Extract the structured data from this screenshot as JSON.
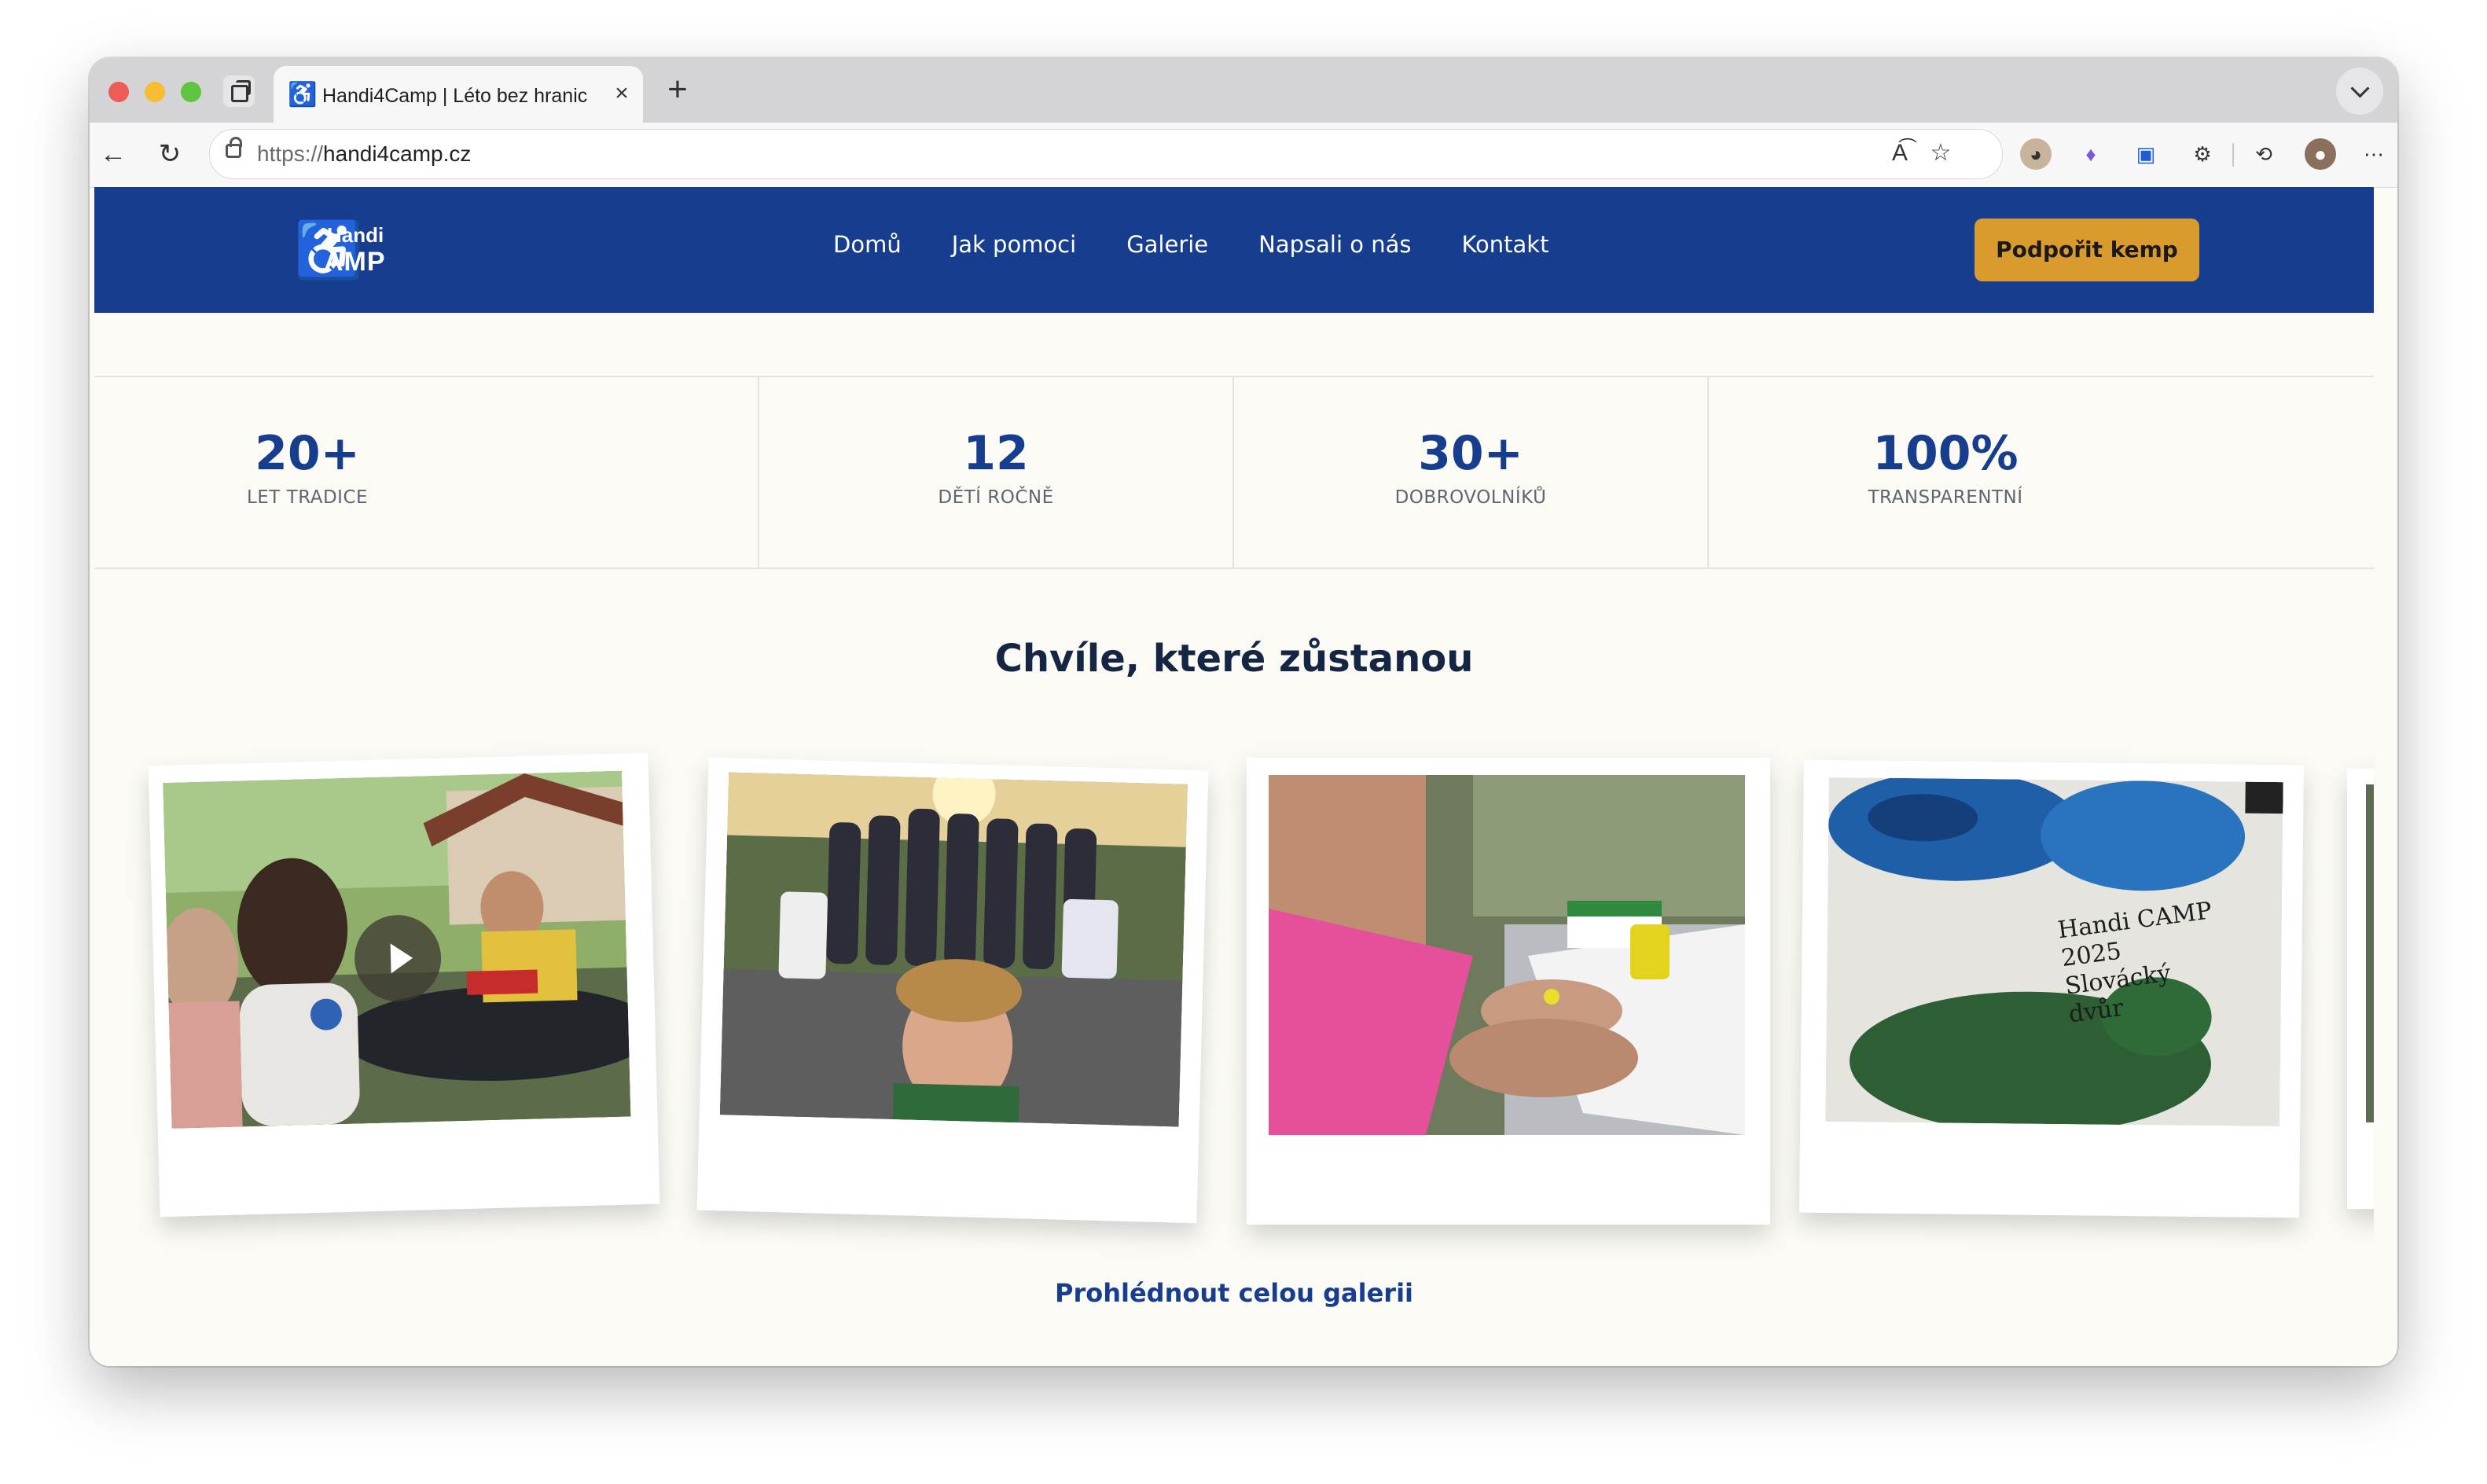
{
  "browser": {
    "tab_title": "Handi4Camp | Léto bez hranic",
    "tab_favicon": "wheelchair-icon",
    "url_scheme": "https://",
    "url_host": "handi4camp.cz"
  },
  "nav": {
    "logo_top": "Handi",
    "logo_bottom": "AMP",
    "links": [
      "Domů",
      "Jak pomoci",
      "Galerie",
      "Napsali o nás",
      "Kontakt"
    ],
    "cta": "Podpořit kemp"
  },
  "stats": [
    {
      "value": "20+",
      "label": "LET TRADICE"
    },
    {
      "value": "12",
      "label": "DĚTÍ ROČNĚ"
    },
    {
      "value": "30+",
      "label": "DOBROVOLNÍKŮ"
    },
    {
      "value": "100%",
      "label": "TRANSPARENTNÍ"
    }
  ],
  "gallery": {
    "title": "Chvíle, které zůstanou",
    "photos": [
      {
        "kind": "video",
        "subject": "girl with glasses at outdoor craft table"
      },
      {
        "kind": "photo",
        "subject": "group selfie at sunset with wheelchairs"
      },
      {
        "kind": "photo",
        "subject": "hands painting with yellow paint"
      },
      {
        "kind": "photo",
        "subject": "painted fabric bag",
        "printed_text": "Handi CAMP 2025 Slovácký dvůr"
      }
    ],
    "link": "Prohlédnout celou galerii"
  },
  "colors": {
    "brand_blue": "#173d8f",
    "cta_orange": "#d99a2e",
    "page_bg": "#fbfaf5"
  }
}
